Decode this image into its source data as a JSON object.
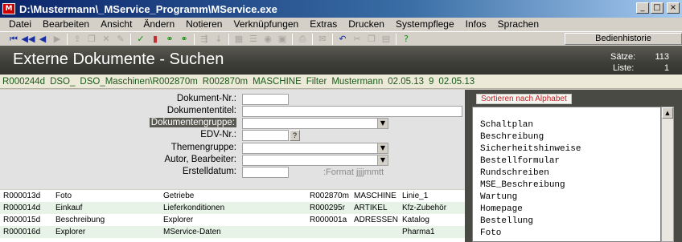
{
  "window": {
    "title": "D:\\Mustermann\\_MService_Programm\\MService.exe",
    "app_icon_text": "M",
    "minimize": "_",
    "maximize": "□",
    "close": "×"
  },
  "menu": [
    "Datei",
    "Bearbeiten",
    "Ansicht",
    "Ändern",
    "Notieren",
    "Verknüpfungen",
    "Extras",
    "Drucken",
    "Systempflege",
    "Infos",
    "Sprachen"
  ],
  "toolbar": {
    "icons": [
      {
        "name": "first-record-icon",
        "glyph": "⏮",
        "style": ""
      },
      {
        "name": "previous-page-icon",
        "glyph": "◀◀",
        "style": ""
      },
      {
        "name": "previous-record-icon",
        "glyph": "◀",
        "style": ""
      },
      {
        "name": "next-record-icon",
        "glyph": "▶",
        "style": "dim"
      },
      {
        "name": "sep",
        "glyph": "",
        "style": ""
      },
      {
        "name": "export-icon",
        "glyph": "⇪",
        "style": "dim"
      },
      {
        "name": "copy-icon",
        "glyph": "❐",
        "style": "dim"
      },
      {
        "name": "delete-icon",
        "glyph": "✕",
        "style": "dim"
      },
      {
        "name": "edit-icon",
        "glyph": "✎",
        "style": "dim"
      },
      {
        "name": "sep",
        "glyph": "",
        "style": ""
      },
      {
        "name": "confirm-icon",
        "glyph": "✓",
        "style": "green"
      },
      {
        "name": "book-icon",
        "glyph": "▮",
        "style": "red"
      },
      {
        "name": "link-icon",
        "glyph": "⚭",
        "style": "green"
      },
      {
        "name": "unlink-icon",
        "glyph": "⚭",
        "style": "green"
      },
      {
        "name": "sep",
        "glyph": "",
        "style": ""
      },
      {
        "name": "share-icon",
        "glyph": "⇶",
        "style": "dim"
      },
      {
        "name": "sort-icon",
        "glyph": "↓",
        "style": "dim"
      },
      {
        "name": "sep",
        "glyph": "",
        "style": ""
      },
      {
        "name": "building-icon",
        "glyph": "▦",
        "style": "dim"
      },
      {
        "name": "list-icon",
        "glyph": "☰",
        "style": "dim"
      },
      {
        "name": "view-icon",
        "glyph": "◉",
        "style": "dim"
      },
      {
        "name": "image-icon",
        "glyph": "▣",
        "style": "dim"
      },
      {
        "name": "sep",
        "glyph": "",
        "style": ""
      },
      {
        "name": "print-icon",
        "glyph": "⎙",
        "style": "dim"
      },
      {
        "name": "sep",
        "glyph": "",
        "style": ""
      },
      {
        "name": "mail-icon",
        "glyph": "✉",
        "style": "dim"
      },
      {
        "name": "sep",
        "glyph": "",
        "style": ""
      },
      {
        "name": "undo-icon",
        "glyph": "↶",
        "style": ""
      },
      {
        "name": "cut-icon",
        "glyph": "✂",
        "style": "dim"
      },
      {
        "name": "copy2-icon",
        "glyph": "❐",
        "style": "dim"
      },
      {
        "name": "paste-icon",
        "glyph": "▤",
        "style": "dim"
      },
      {
        "name": "sep",
        "glyph": "",
        "style": ""
      },
      {
        "name": "help-icon",
        "glyph": "?",
        "style": "green"
      }
    ],
    "history_button": "Bedienhistorie"
  },
  "header": {
    "title": "Externe Dokumente  -  Suchen",
    "records_label": "Sätze:",
    "records_value": "113",
    "list_label": "Liste:",
    "list_value": "1"
  },
  "infobar": [
    "R000244d",
    "DSO_",
    "DSO_Maschinen\\R002870m",
    "R002870m",
    "MASCHINE",
    "Filter",
    "Mustermann",
    "02.05.13",
    "9",
    "02.05.13"
  ],
  "search_form": {
    "document_no_label": "Dokument-Nr.:",
    "document_no_value": "",
    "document_title_label": "Dokumententitel:",
    "document_title_value": "",
    "document_group_label": "Dokumentengruppe:",
    "document_group_value": "",
    "edv_no_label": "EDV-Nr.:",
    "edv_no_value": "",
    "edv_lookup": "?",
    "topic_group_label": "Themengruppe:",
    "topic_group_value": "",
    "author_label": "Autor, Bearbeiter:",
    "author_value": "",
    "created_label": "Erstelldatum:",
    "created_value": "",
    "format_hint": ":Format jjjjmmtt",
    "combo_arrow": "▼"
  },
  "results": [
    [
      "R000013d",
      "Foto",
      "Getriebe",
      "R002870m",
      "MASCHINE",
      "Linie_1"
    ],
    [
      "R000014d",
      "Einkauf",
      "Lieferkonditionen",
      "R000295r",
      "ARTIKEL",
      "Kfz-Zubehör"
    ],
    [
      "R000015d",
      "Beschreibung",
      "Explorer",
      "R000001a",
      "ADRESSEN",
      "Katalog"
    ],
    [
      "R000016d",
      "Explorer",
      "MService-Daten",
      "",
      "",
      "Pharma1"
    ]
  ],
  "right_panel": {
    "sort_button": "Sortieren nach Alphabet",
    "items": [
      "Schaltplan",
      "Beschreibung",
      "Sicherheitshinweise",
      "Bestellformular",
      "Rundschreiben",
      "MSE_Beschreibung",
      "Wartung",
      "Homepage",
      "Bestellung",
      "Foto"
    ],
    "scroll_up": "▲"
  }
}
